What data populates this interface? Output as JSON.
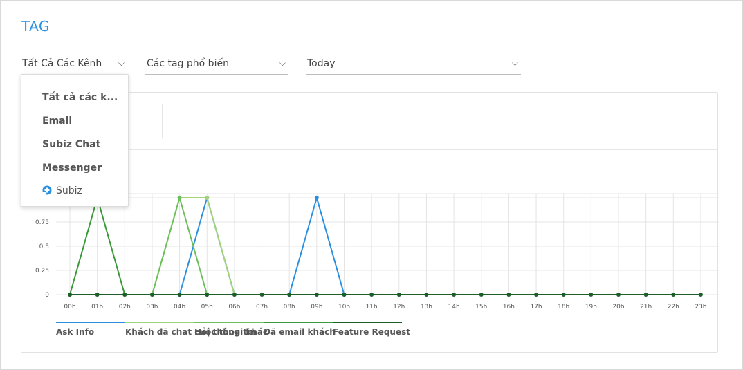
{
  "header": {
    "title": "TAG"
  },
  "filters": {
    "channel": "Tất Cả Các Kênh",
    "tag": "Các tag phổ biến",
    "range": "Today"
  },
  "dropdown": {
    "items": [
      "Tất cả các k...",
      "Email",
      "Subiz Chat",
      "Messenger"
    ],
    "last_item": "Subiz"
  },
  "colors": {
    "accent": "#2b8fe0",
    "ask_info": "#2b8fe0",
    "khach_da_chat": "#a5d37a",
    "hoi_thong_tin": "#6cbf5a",
    "da_email_khach": "#3a9a3a",
    "feature_request": "#1e5e2a"
  },
  "chart_data": {
    "type": "line",
    "x": [
      "00h",
      "01h",
      "02h",
      "03h",
      "04h",
      "05h",
      "06h",
      "07h",
      "08h",
      "09h",
      "10h",
      "11h",
      "12h",
      "13h",
      "14h",
      "15h",
      "16h",
      "17h",
      "18h",
      "19h",
      "20h",
      "21h",
      "22h",
      "23h"
    ],
    "yticks": [
      "0",
      "0.25",
      "0.5",
      "0.75"
    ],
    "ylim": [
      0,
      1
    ],
    "grid": true,
    "legend_position": "bottom",
    "series": [
      {
        "name": "Ask Info",
        "color": "#2b8fe0",
        "values": [
          null,
          null,
          null,
          null,
          0,
          1,
          0,
          null,
          0,
          1,
          0,
          null,
          null,
          null,
          null,
          null,
          null,
          null,
          null,
          null,
          null,
          null,
          null,
          null
        ]
      },
      {
        "name": "Khách đã chat cuộc thoại khác",
        "color": "#a5d37a",
        "values": [
          null,
          null,
          null,
          0,
          1,
          1,
          0,
          null,
          null,
          null,
          null,
          null,
          null,
          null,
          null,
          null,
          null,
          null,
          null,
          null,
          null,
          null,
          null,
          null
        ]
      },
      {
        "name": "Hỏi thông tin",
        "color": "#6cbf5a",
        "values": [
          null,
          null,
          null,
          0,
          1,
          0,
          null,
          null,
          null,
          null,
          null,
          null,
          null,
          null,
          null,
          null,
          null,
          null,
          null,
          null,
          null,
          null,
          null,
          null
        ]
      },
      {
        "name": "Đã email khách",
        "color": "#3a9a3a",
        "values": [
          0,
          1,
          0,
          null,
          null,
          null,
          null,
          null,
          null,
          null,
          null,
          null,
          null,
          null,
          null,
          null,
          null,
          null,
          null,
          null,
          null,
          null,
          null,
          null
        ]
      },
      {
        "name": "Feature Request",
        "color": "#1e5e2a",
        "values": [
          0,
          0,
          0,
          0,
          0,
          0,
          0,
          0,
          0,
          0,
          0,
          0,
          0,
          0,
          0,
          0,
          0,
          0,
          0,
          0,
          0,
          0,
          0,
          0
        ]
      }
    ]
  }
}
